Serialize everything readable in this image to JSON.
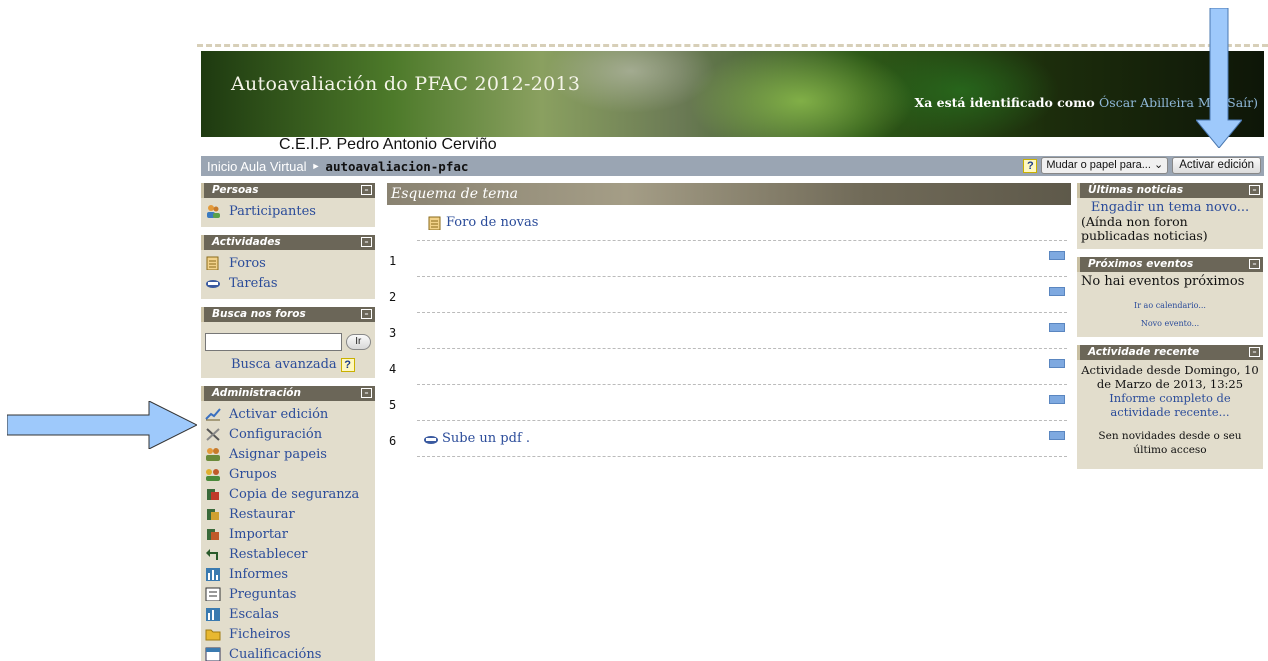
{
  "header": {
    "site_title": "Autoavaliación do PFAC 2012-2013",
    "login_prefix": "Xa está identificado como",
    "login_user": "Óscar Abilleira Mui",
    "logout_label": "Saír)",
    "school_name": "C.E.I.P. Pedro Antonio Cerviño"
  },
  "navbar": {
    "home": "Inicio Aula Virtual",
    "current": "autoavaliacion-pfac",
    "help": "?",
    "role_select": "Mudar o papel para...",
    "edit_button": "Activar edición"
  },
  "blocks_left": {
    "persoas": {
      "title": "Persoas",
      "items": [
        "Participantes"
      ]
    },
    "actividades": {
      "title": "Actividades",
      "items": [
        "Foros",
        "Tarefas"
      ]
    },
    "busca": {
      "title": "Busca nos foros",
      "go": "Ir",
      "advanced": "Busca avanzada"
    },
    "admin": {
      "title": "Administración",
      "items": [
        "Activar edición",
        "Configuración",
        "Asignar papeis",
        "Grupos",
        "Copia de seguranza",
        "Restaurar",
        "Importar",
        "Restablecer",
        "Informes",
        "Preguntas",
        "Escalas",
        "Ficheiros",
        "Cualificacións"
      ]
    }
  },
  "center": {
    "title": "Esquema de tema",
    "news_forum": "Foro de novas",
    "sections": [
      "1",
      "2",
      "3",
      "4",
      "5",
      "6"
    ],
    "section6_item": "Sube un pdf ."
  },
  "blocks_right": {
    "news": {
      "title": "Últimas noticias",
      "add": "Engadir un tema novo...",
      "none": "(Aínda non foron publicadas noticias)"
    },
    "events": {
      "title": "Próximos eventos",
      "none": "No hai eventos próximos",
      "calendar": "Ir ao calendario...",
      "new_event": "Novo evento..."
    },
    "recent": {
      "title": "Actividade recente",
      "since": "Actividade desde Domingo, 10 de Marzo de 2013, 13:25",
      "report": "Informe completo de actividade recente...",
      "nothing": "Sen novidades desde o seu último acceso"
    }
  },
  "icons": {
    "toggle": "minus-box-icon",
    "users": "people-icon",
    "forum": "forum-icon",
    "assignment": "assignment-icon",
    "help": "help-icon",
    "annotation_arrow": "arrow-icon"
  },
  "colors": {
    "link": "#2b4c9a",
    "block_bg": "#e2ddcc",
    "block_header": "#6b6658",
    "navbar": "#9aa5b3",
    "arrow": "#9ec9fb"
  }
}
